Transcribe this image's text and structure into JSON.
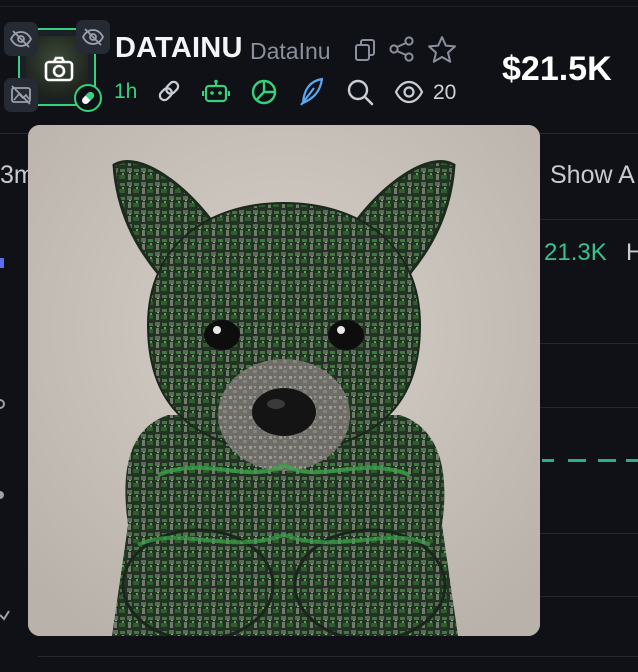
{
  "token": {
    "symbol": "DATAINU",
    "name": "DataInu",
    "age": "1h",
    "views": "20",
    "market_cap": "$21.5K"
  },
  "background": {
    "left_tab_partial": "3m",
    "show_button_partial": "Show A",
    "row_value": "21.3K",
    "row_suffix": "H"
  },
  "colors": {
    "accent_green": "#34d27a",
    "teal_value": "#39c28f",
    "bg": "#0f1116"
  },
  "icons": {
    "copy": "copy-icon",
    "share": "share-icon",
    "favorite": "star-icon",
    "link": "link-icon",
    "bot": "bot-icon",
    "chart": "pie-chart-icon",
    "feather": "feather-icon",
    "search": "search-icon",
    "views": "eye-icon",
    "camera": "camera-icon",
    "pill": "pill-icon"
  },
  "popup": {
    "image_description_alt": "Dog sculpture made of green circuit boards"
  }
}
